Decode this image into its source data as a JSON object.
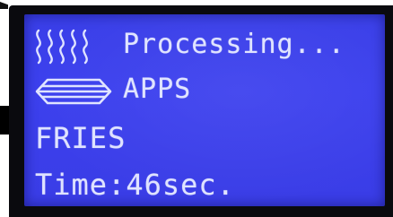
{
  "display": {
    "status": "Processing...",
    "category": "APPS",
    "item": "FRIES",
    "time": "Time:46sec."
  },
  "icons": {
    "row1": "steam-icon",
    "row2": "fryer-basket-icon"
  },
  "colors": {
    "lcd_background": "#3c40ee",
    "lcd_text": "#dfe3ff",
    "bezel": "#0a0a0e"
  }
}
